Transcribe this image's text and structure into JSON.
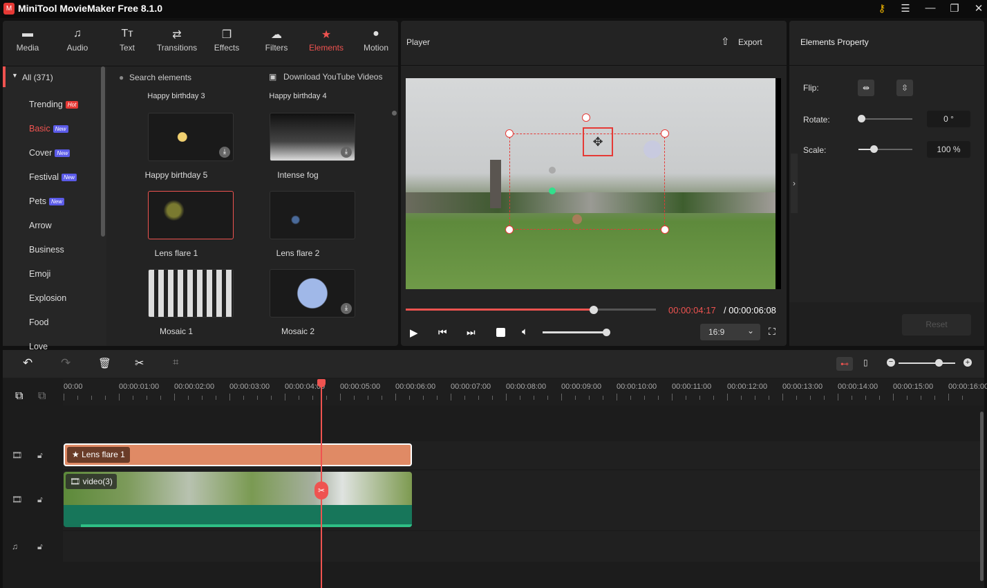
{
  "app": {
    "title": "MiniTool MovieMaker Free 8.1.0",
    "logo_text": "M"
  },
  "window_controls": [
    "key-icon",
    "menu-icon",
    "minimize-icon",
    "maximize-icon",
    "close-icon"
  ],
  "tabs": [
    {
      "label": "Media",
      "icon": "folder-icon"
    },
    {
      "label": "Audio",
      "icon": "music-icon"
    },
    {
      "label": "Text",
      "icon": "text-icon"
    },
    {
      "label": "Transitions",
      "icon": "transition-icon"
    },
    {
      "label": "Effects",
      "icon": "effects-icon"
    },
    {
      "label": "Filters",
      "icon": "filters-icon"
    },
    {
      "label": "Elements",
      "icon": "elements-icon",
      "active": true
    },
    {
      "label": "Motion",
      "icon": "motion-icon"
    }
  ],
  "categories": {
    "all": "All (371)",
    "items": [
      {
        "label": "Trending",
        "badge": "Hot"
      },
      {
        "label": "Basic",
        "badge": "New",
        "active": true
      },
      {
        "label": "Cover",
        "badge": "New"
      },
      {
        "label": "Festival",
        "badge": "New"
      },
      {
        "label": "Pets",
        "badge": "New"
      },
      {
        "label": "Arrow"
      },
      {
        "label": "Business"
      },
      {
        "label": "Emoji"
      },
      {
        "label": "Explosion"
      },
      {
        "label": "Food"
      },
      {
        "label": "Love"
      }
    ]
  },
  "search": {
    "placeholder": "Search elements",
    "download_label": "Download YouTube Videos"
  },
  "elements": [
    {
      "label": "Happy birthday 3"
    },
    {
      "label": "Happy birthday 4"
    },
    {
      "label": "Happy birthday 5",
      "download": true
    },
    {
      "label": "Intense fog",
      "download": true
    },
    {
      "label": "Lens flare 1",
      "selected": true
    },
    {
      "label": "Lens flare 2"
    },
    {
      "label": "Mosaic 1"
    },
    {
      "label": "Mosaic 2",
      "download": true
    }
  ],
  "player": {
    "title": "Player",
    "export_label": "Export",
    "current_time": "00:00:04:17",
    "total_time": "/ 00:00:06:08",
    "progress": 0.75,
    "volume": 0.9,
    "aspect": "16:9"
  },
  "properties": {
    "title": "Elements Property",
    "flip_label": "Flip:",
    "rotate_label": "Rotate:",
    "rotate_value": "0 °",
    "rotate_level": 0,
    "scale_label": "Scale:",
    "scale_value": "100 %",
    "scale_level": 0.3,
    "reset_label": "Reset"
  },
  "timeline": {
    "ruler": [
      "00:00",
      "00:00:01:00",
      "00:00:02:00",
      "00:00:03:00",
      "00:00:04:00",
      "00:00:05:00",
      "00:00:06:00",
      "00:00:07:00",
      "00:00:08:00",
      "00:00:09:00",
      "00:00:10:00",
      "00:00:11:00",
      "00:00:12:00",
      "00:00:13:00",
      "00:00:14:00",
      "00:00:15:00",
      "00:00:16:00"
    ],
    "zoom_level": 0.75,
    "element_clip": "Lens flare 1",
    "video_clip": "video(3)"
  },
  "colors": {
    "accent": "#ef5350",
    "clip": "#e08a65",
    "audio": "#17765a"
  }
}
